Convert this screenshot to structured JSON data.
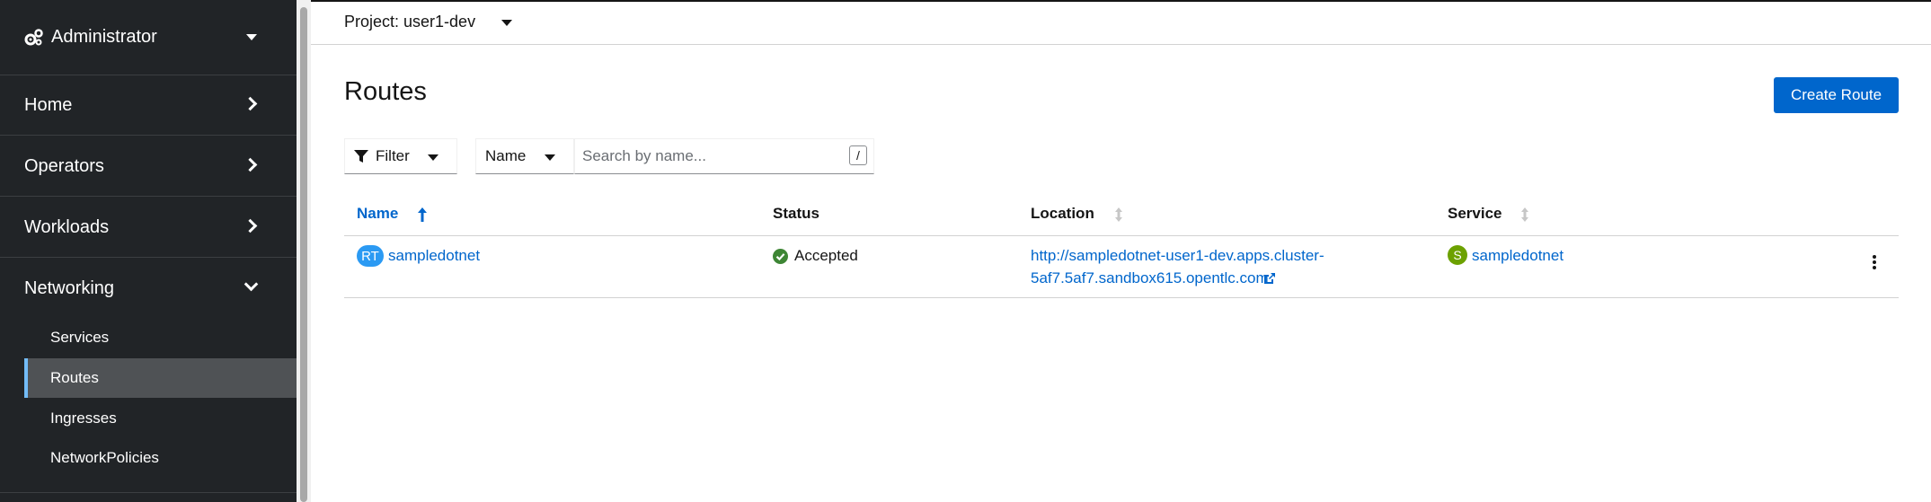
{
  "sidebar": {
    "perspective": "Administrator",
    "groups": [
      {
        "label": "Home"
      },
      {
        "label": "Operators"
      },
      {
        "label": "Workloads"
      },
      {
        "label": "Networking"
      }
    ],
    "networking_items": [
      {
        "label": "Services"
      },
      {
        "label": "Routes"
      },
      {
        "label": "Ingresses"
      },
      {
        "label": "NetworkPolicies"
      }
    ]
  },
  "project": {
    "label": "Project: user1-dev"
  },
  "page": {
    "title": "Routes",
    "create_button": "Create Route"
  },
  "toolbar": {
    "filter_label": "Filter",
    "name_select": "Name",
    "search_placeholder": "Search by name...",
    "search_hint": "/"
  },
  "table": {
    "columns": [
      "Name",
      "Status",
      "Location",
      "Service"
    ],
    "rows": [
      {
        "badge": "RT",
        "name": "sampledotnet",
        "status": "Accepted",
        "location_line1": "http://sampledotnet-user1-dev.apps.cluster-",
        "location_line2": "5af7.5af7.sandbox615.opentlc.com",
        "service_badge": "S",
        "service": "sampledotnet"
      }
    ]
  },
  "colors": {
    "accent": "#0066cc",
    "sidebar_bg": "#212427",
    "active_indicator": "#73bcf7",
    "route_badge": "#2b9af3",
    "service_badge": "#6ca100",
    "success": "#3e8635"
  }
}
